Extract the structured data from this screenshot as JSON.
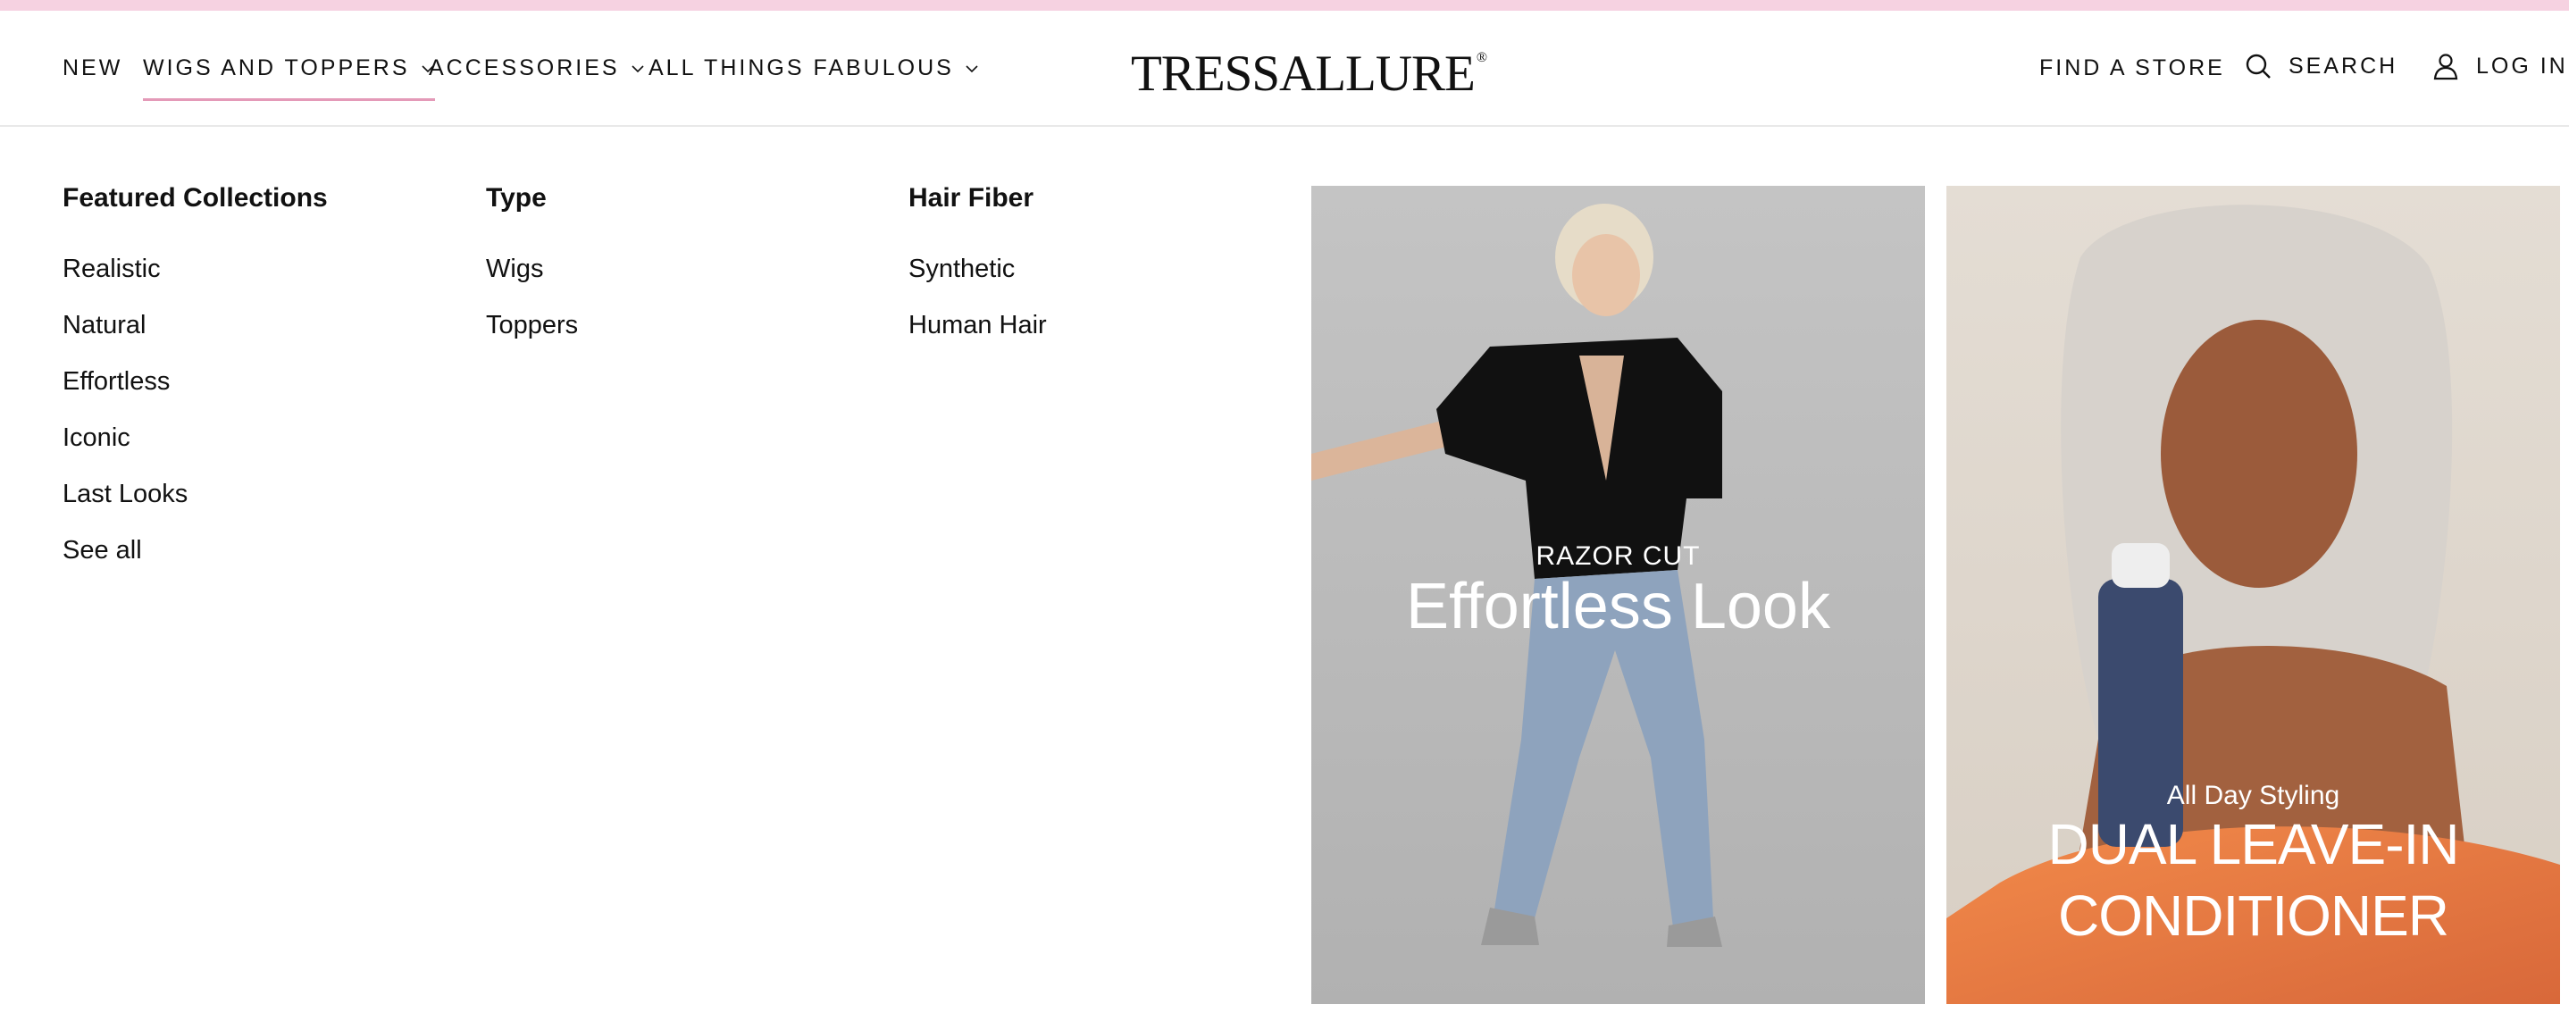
{
  "brand": {
    "logo_text": "TRESSALLURE",
    "registered_mark": "®"
  },
  "nav": {
    "items": [
      {
        "label": "NEW",
        "has_dropdown": false
      },
      {
        "label": "WIGS AND TOPPERS",
        "has_dropdown": true,
        "active": true
      },
      {
        "label": "ACCESSORIES",
        "has_dropdown": true
      },
      {
        "label": "ALL THINGS FABULOUS",
        "has_dropdown": true
      }
    ],
    "utility": {
      "find_store": "FIND A STORE",
      "search": "SEARCH",
      "login": "LOG IN"
    }
  },
  "mega_menu": {
    "columns": [
      {
        "title": "Featured Collections",
        "links": [
          "Realistic",
          "Natural",
          "Effortless",
          "Iconic",
          "Last Looks",
          "See all"
        ]
      },
      {
        "title": "Type",
        "links": [
          "Wigs",
          "Toppers"
        ]
      },
      {
        "title": "Hair Fiber",
        "links": [
          "Synthetic",
          "Human Hair"
        ]
      }
    ],
    "promos": [
      {
        "eyebrow": "RAZOR CUT",
        "headline": "Effortless Look"
      },
      {
        "eyebrow": "All Day Styling",
        "headline_line1": "DUAL LEAVE-IN",
        "headline_line2": "CONDITIONER"
      }
    ]
  },
  "colors": {
    "accent_pink": "#e49ab8",
    "top_strip": "#f6d2e1",
    "divider": "#e9e9e9",
    "text": "#111111"
  }
}
